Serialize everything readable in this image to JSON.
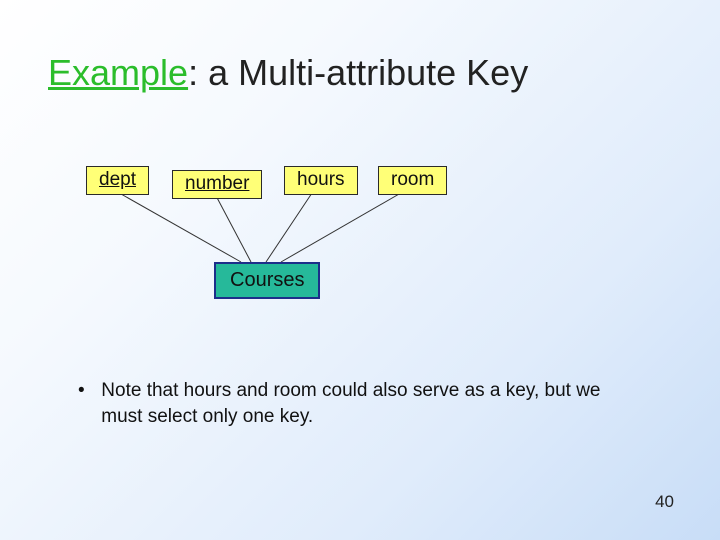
{
  "title": {
    "accent": "Example",
    "rest": ": a Multi-attribute Key"
  },
  "diagram": {
    "attributes": [
      {
        "label": "dept",
        "key": true
      },
      {
        "label": "number",
        "key": true
      },
      {
        "label": "hours",
        "key": false
      },
      {
        "label": "room",
        "key": false
      }
    ],
    "entity": "Courses"
  },
  "note": {
    "bullet": "•",
    "text": "Note that hours and room could also serve as a key, but we must select only one key."
  },
  "page_number": "40"
}
